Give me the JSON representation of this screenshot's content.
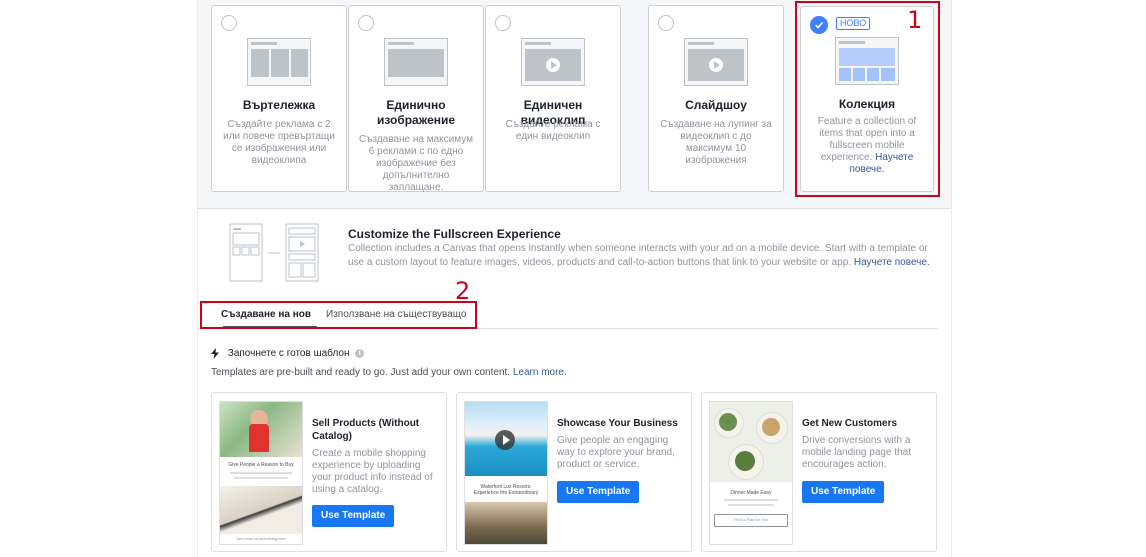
{
  "formats": [
    {
      "title": "Въртележка",
      "desc": "Създайте реклама с 2 или повече превъртащи се изображения или видеоклипа",
      "selected": false
    },
    {
      "title": "Единично изображение",
      "desc": "Създаване на максимум 6 реклами с по едно изображение без допълнително заплащане.",
      "selected": false
    },
    {
      "title": "Единичен видеоклип",
      "desc": "Създайте реклама с един видеоклип",
      "selected": false
    },
    {
      "title": "Слайдшоу",
      "desc": "Създаване на лупинг за видеоклип с до максимум 10 изображения",
      "selected": false
    },
    {
      "title": "Колекция",
      "desc": "Feature a collection of items that open into a fullscreen mobile experience.",
      "link": "Научете повече.",
      "badge": "НОВО",
      "selected": true
    }
  ],
  "annotations": {
    "one": "1",
    "two": "2"
  },
  "fullscreen": {
    "title": "Customize the Fullscreen Experience",
    "desc": "Collection includes a Canvas that opens instantly when someone interacts with your ad on a mobile device. Start with a template or use a custom layout to feature images, videos, products and call-to-action buttons that link to your website or app.",
    "link": "Научете повече."
  },
  "tabs": {
    "create_new": "Създаване на нов",
    "use_existing": "Използване на съществуващо"
  },
  "templates_section": {
    "heading": "Започнете с готов шаблон",
    "sub": "Templates are pre-built and ready to go. Just add your own content.",
    "sub_link": "Learn more."
  },
  "templates": [
    {
      "title": "Sell Products (Without Catalog)",
      "desc": "Create a mobile shopping experience by uploading your product info instead of using a catalog.",
      "button": "Use Template",
      "phone_text": "Give People a Reason to Buy",
      "phone_footer": "See more at acclothing.com"
    },
    {
      "title": "Showcase Your Business",
      "desc": "Give people an engaging way to explore your brand, product or service.",
      "button": "Use Template",
      "phone_text": "Waterfont Lux Resorts: Experience the Extraordinary"
    },
    {
      "title": "Get New Customers",
      "desc": "Drive conversions with a mobile landing page that encourages action.",
      "button": "Use Template",
      "phone_text": "Dinner Made Easy",
      "phone_button": "Find a Plan for You"
    }
  ],
  "colors": {
    "accent": "#4080ff",
    "button": "#1877f2",
    "annotation": "#d0021b",
    "link": "#365899"
  }
}
